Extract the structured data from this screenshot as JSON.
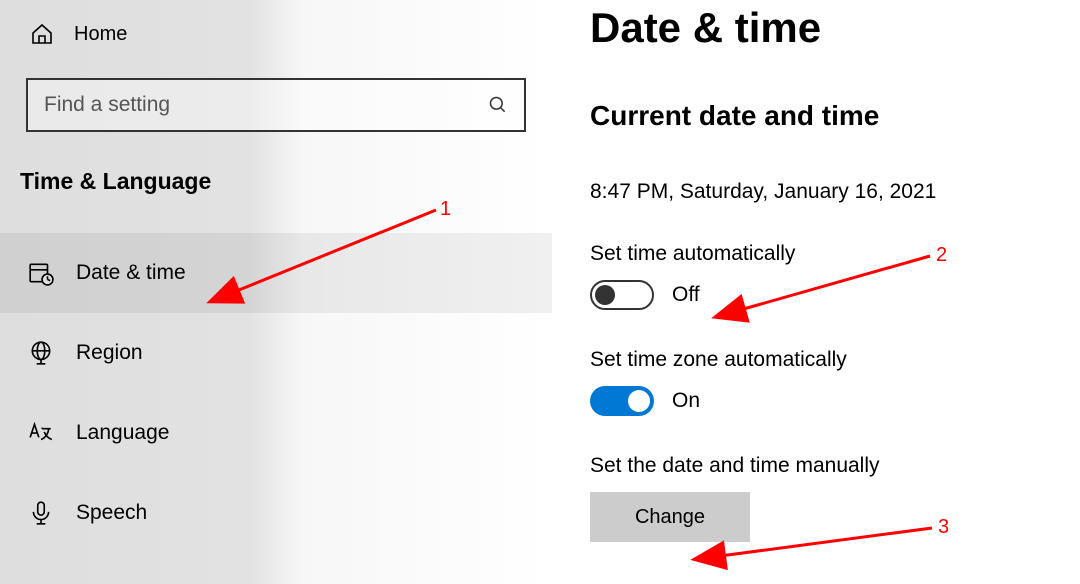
{
  "sidebar": {
    "home_label": "Home",
    "search_placeholder": "Find a setting",
    "category": "Time & Language",
    "items": [
      {
        "label": "Date & time",
        "icon": "calendar-clock-icon",
        "selected": true
      },
      {
        "label": "Region",
        "icon": "globe-icon",
        "selected": false
      },
      {
        "label": "Language",
        "icon": "language-az-icon",
        "selected": false
      },
      {
        "label": "Speech",
        "icon": "microphone-icon",
        "selected": false
      }
    ]
  },
  "main": {
    "title": "Date & time",
    "section_heading": "Current date and time",
    "current_datetime": "8:47 PM, Saturday, January 16, 2021",
    "set_time_auto_label": "Set time automatically",
    "set_time_auto_state": "Off",
    "set_tz_auto_label": "Set time zone automatically",
    "set_tz_auto_state": "On",
    "set_manual_label": "Set the date and time manually",
    "change_button": "Change"
  },
  "annotations": {
    "n1": "1",
    "n2": "2",
    "n3": "3"
  }
}
